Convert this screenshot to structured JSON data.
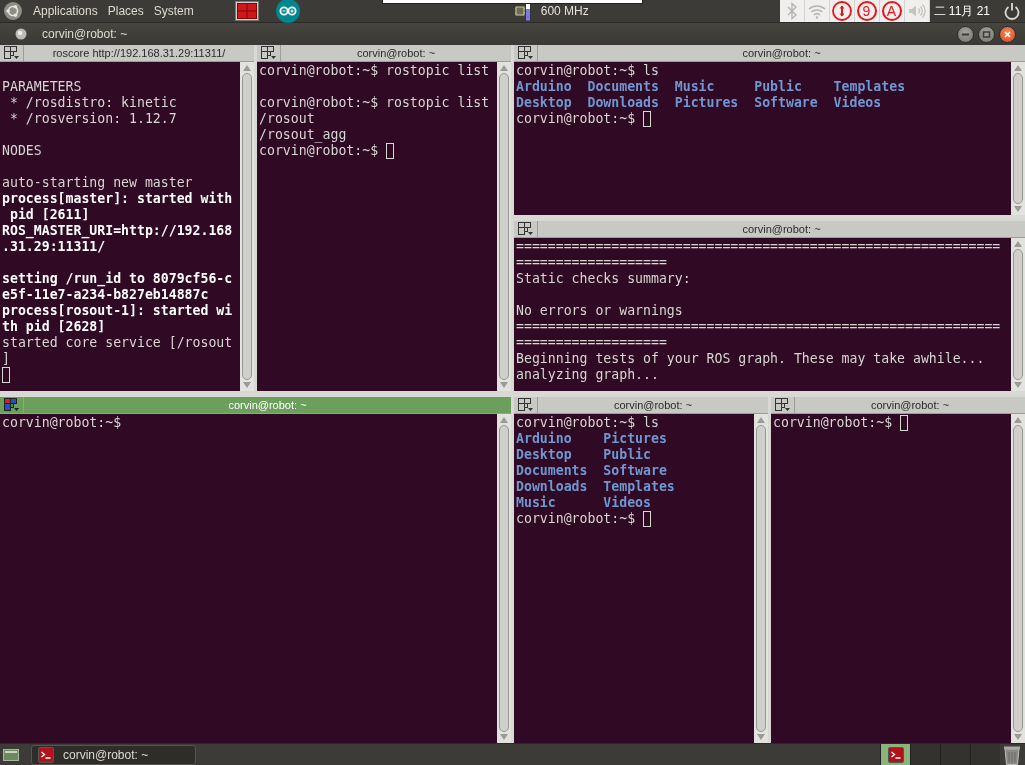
{
  "top_panel": {
    "menus": [
      "Applications",
      "Places",
      "System"
    ],
    "cpu_frequency": "600 MHz",
    "indicator_labels": [
      "9",
      "A"
    ],
    "clock": "二 11月 21"
  },
  "window": {
    "title": "corvin@robot: ~"
  },
  "terminal": {
    "kind": "stacked",
    "children": [
      {
        "kind": "side_by_side",
        "children": [
          {
            "kind": "side_by_side",
            "children": [
              {
                "kind": "pane",
                "title": "roscore http://192.168.31.29:11311/",
                "focused": false,
                "lines": [
                  {
                    "kind": "blank"
                  },
                  {
                    "kind": "text",
                    "text": "PARAMETERS"
                  },
                  {
                    "kind": "text",
                    "text": " * /rosdistro: kinetic"
                  },
                  {
                    "kind": "text",
                    "text": " * /rosversion: 1.12.7"
                  },
                  {
                    "kind": "blank"
                  },
                  {
                    "kind": "text",
                    "text": "NODES"
                  },
                  {
                    "kind": "blank"
                  },
                  {
                    "kind": "text",
                    "text": "auto-starting new master"
                  },
                  {
                    "kind": "bold",
                    "text": "process[master]: started with"
                  },
                  {
                    "kind": "bold",
                    "text": " pid [2611]"
                  },
                  {
                    "kind": "bold",
                    "text": "ROS_MASTER_URI=http://192.168"
                  },
                  {
                    "kind": "bold",
                    "text": ".31.29:11311/"
                  },
                  {
                    "kind": "blank"
                  },
                  {
                    "kind": "bold",
                    "text": "setting /run_id to 8079cf56-c"
                  },
                  {
                    "kind": "bold",
                    "text": "e5f-11e7-a234-b827eb14887c"
                  },
                  {
                    "kind": "bold",
                    "text": "process[rosout-1]: started wi"
                  },
                  {
                    "kind": "bold",
                    "text": "th pid [2628]"
                  },
                  {
                    "kind": "text",
                    "text": "started core service [/rosout"
                  },
                  {
                    "kind": "text",
                    "text": "]"
                  },
                  {
                    "kind": "input"
                  }
                ]
              },
              {
                "kind": "pane",
                "title": "corvin@robot: ~",
                "focused": false,
                "lines": [
                  {
                    "kind": "text",
                    "text": "corvin@robot:~$ rostopic list"
                  },
                  {
                    "kind": "blank"
                  },
                  {
                    "kind": "text",
                    "text": "corvin@robot:~$ rostopic list"
                  },
                  {
                    "kind": "text",
                    "text": "/rosout"
                  },
                  {
                    "kind": "text",
                    "text": "/rosout_agg"
                  },
                  {
                    "kind": "input",
                    "text": "corvin@robot:~$"
                  }
                ]
              }
            ]
          },
          {
            "kind": "stacked",
            "children": [
              {
                "kind": "pane",
                "title": "corvin@robot: ~",
                "focused": false,
                "lines": [
                  {
                    "kind": "text",
                    "text": "corvin@robot:~$ ls"
                  },
                  {
                    "kind": "listing",
                    "columns": [
                      [
                        "Arduino",
                        "Desktop"
                      ],
                      [
                        "Documents",
                        "Downloads"
                      ],
                      [
                        "Music",
                        "Pictures"
                      ],
                      [
                        "Public",
                        "Software"
                      ],
                      [
                        "Templates",
                        "Videos"
                      ]
                    ]
                  },
                  {
                    "kind": "input",
                    "text": "corvin@robot:~$"
                  }
                ]
              },
              {
                "kind": "pane",
                "title": "corvin@robot: ~",
                "focused": false,
                "lines": [
                  {
                    "kind": "text",
                    "text": "============================================================="
                  },
                  {
                    "kind": "text",
                    "text": "==================="
                  },
                  {
                    "kind": "text",
                    "text": "Static checks summary:"
                  },
                  {
                    "kind": "blank"
                  },
                  {
                    "kind": "text",
                    "text": "No errors or warnings"
                  },
                  {
                    "kind": "text",
                    "text": "============================================================="
                  },
                  {
                    "kind": "text",
                    "text": "==================="
                  },
                  {
                    "kind": "text",
                    "text": "Beginning tests of your ROS graph. These may take awhile..."
                  },
                  {
                    "kind": "text",
                    "text": "analyzing graph..."
                  }
                ]
              }
            ]
          }
        ]
      },
      {
        "kind": "side_by_side",
        "children": [
          {
            "kind": "pane",
            "title": "corvin@robot: ~",
            "focused": true,
            "lines": [
              {
                "kind": "text",
                "text": "corvin@robot:~$"
              }
            ]
          },
          {
            "kind": "side_by_side",
            "children": [
              {
                "kind": "pane",
                "title": "corvin@robot: ~",
                "focused": false,
                "lines": [
                  {
                    "kind": "text",
                    "text": "corvin@robot:~$ ls"
                  },
                  {
                    "kind": "listing",
                    "columns": [
                      [
                        "Arduino",
                        "Desktop",
                        "Documents",
                        "Downloads",
                        "Music"
                      ],
                      [
                        "Pictures",
                        "Public",
                        "Software",
                        "Templates",
                        "Videos"
                      ]
                    ]
                  },
                  {
                    "kind": "input",
                    "text": "corvin@robot:~$"
                  }
                ]
              },
              {
                "kind": "pane",
                "title": "corvin@robot: ~",
                "focused": false,
                "lines": [
                  {
                    "kind": "input",
                    "text": "corvin@robot:~$"
                  }
                ]
              }
            ]
          }
        ]
      }
    ]
  },
  "taskbar": {
    "tasks": [
      "corvin@robot: ~"
    ],
    "workspaces": [
      {
        "selected": true
      },
      {
        "selected": false
      },
      {
        "selected": false
      },
      {
        "selected": false
      }
    ]
  }
}
